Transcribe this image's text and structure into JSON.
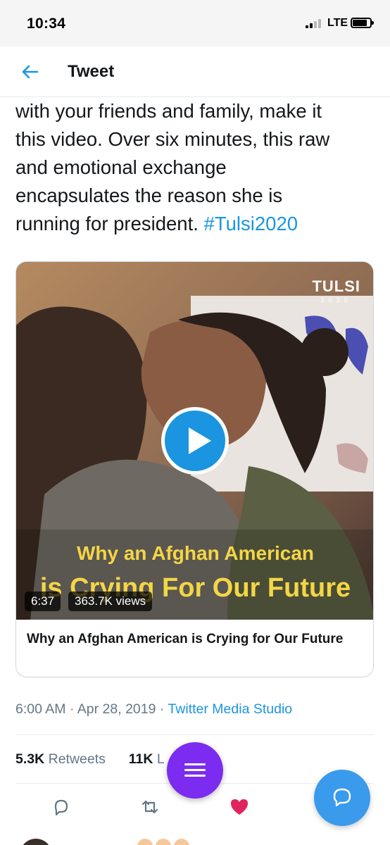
{
  "status_bar": {
    "time": "10:34",
    "network": "LTE"
  },
  "nav": {
    "back_icon": "arrow-left-icon",
    "title": "Tweet"
  },
  "tweet": {
    "text_lines": [
      "with your friends and family, make it",
      "this video. Over six minutes, this raw",
      "and emotional exchange",
      "encapsulates the reason she is",
      "running for president."
    ],
    "hashtag": "#Tulsi2020",
    "media": {
      "brand_name": "TULSI",
      "brand_year": "2020",
      "overlay_line_1": "Why an Afghan American",
      "overlay_line_2": "is Crying For Our Future",
      "duration": "6:37",
      "views": "363.7K views",
      "card_title": "Why an Afghan American is Crying for Our Future"
    },
    "timestamp": "6:00 AM · Apr 28, 2019",
    "separator": "·",
    "source": "Twitter Media Studio",
    "stats": {
      "retweets_count": "5.3K",
      "retweets_label": "Retweets",
      "likes_count": "11K",
      "likes_label": "L"
    }
  },
  "actions": [
    "reply-icon",
    "retweet-icon",
    "like-icon",
    "share-icon"
  ],
  "colors": {
    "link_blue": "#1b95e0",
    "like_red": "#e0245e",
    "menu_fab_purple": "#7b2cf0",
    "compose_fab_blue": "#3a9aec",
    "overlay_yellow": "#f4d646"
  }
}
